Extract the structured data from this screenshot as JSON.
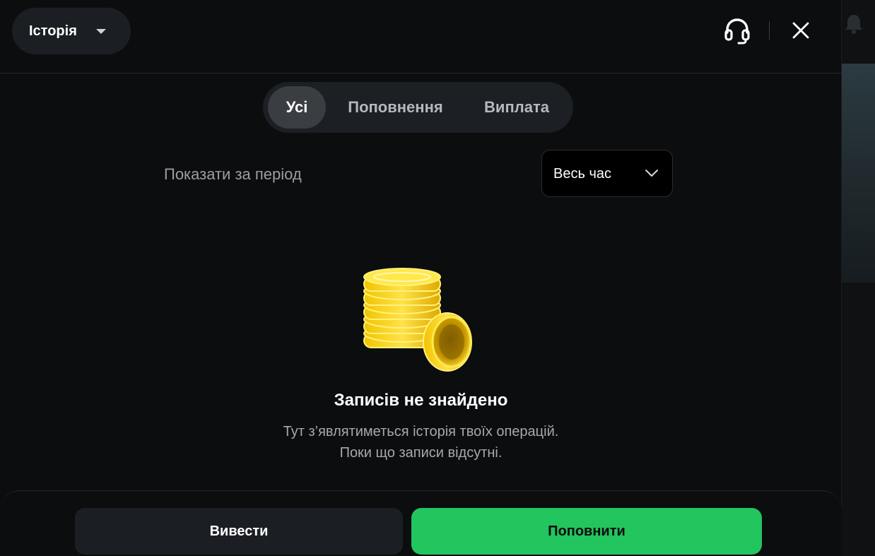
{
  "header": {
    "history_label": "Історія",
    "icons": {
      "support": "headset-icon",
      "close": "close-icon",
      "dropdown": "caret-down-icon"
    }
  },
  "tabs": [
    {
      "label": "Усі",
      "active": true
    },
    {
      "label": "Поповнення",
      "active": false
    },
    {
      "label": "Виплата",
      "active": false
    }
  ],
  "filter": {
    "label": "Показати за період",
    "selected": "Весь час",
    "icon": "chevron-down-icon"
  },
  "empty_state": {
    "icon": "gold-coins-illustration",
    "title": "Записів не знайдено",
    "line1": "Тут з’являтиметься історія твоїх операцій.",
    "line2": "Поки що записи відсутні."
  },
  "footer": {
    "withdraw_label": "Вивести",
    "deposit_label": "Поповнити"
  },
  "colors": {
    "background": "#0c0d0f",
    "accent_green": "#22c55e",
    "coin_gold": "#ffd400"
  }
}
